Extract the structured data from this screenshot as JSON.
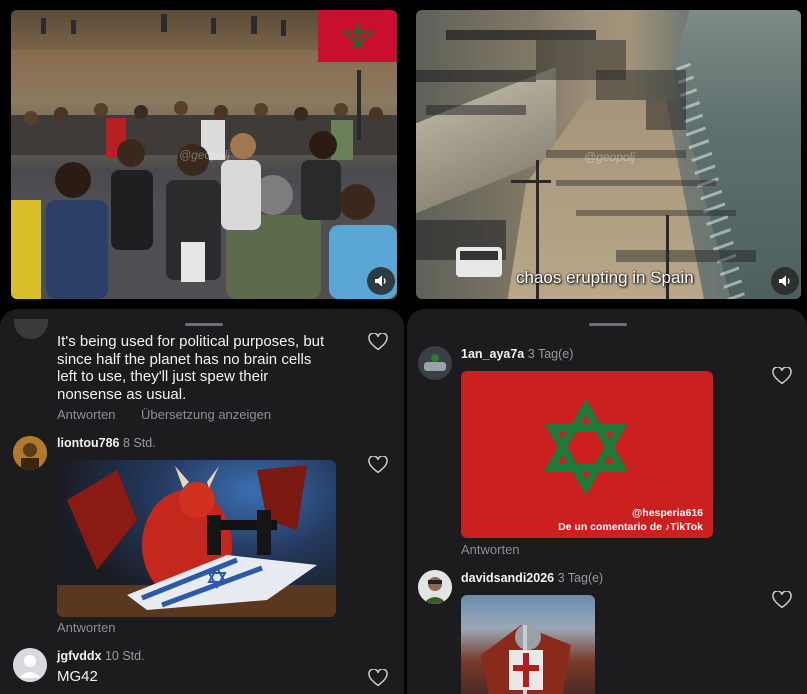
{
  "left_video": {
    "watermark": "@geopolj",
    "icons": {
      "flag": "morocco-flag",
      "volume": "speaker-icon"
    }
  },
  "right_video": {
    "caption": "chaos erupting in Spain",
    "watermark": "@geopolj",
    "icons": {
      "volume": "speaker-icon"
    }
  },
  "left_comments": {
    "partial_comment": {
      "text_lines": [
        "It's being used for political purposes, but",
        "since half the planet has no brain cells",
        "left to use, they'll just spew their",
        "nonsense as usual."
      ],
      "reply_label": "Antworten",
      "translate_label": "Übersetzung anzeigen"
    },
    "comment2": {
      "username": "liontou786",
      "time": "8 Std.",
      "reply_label": "Antworten"
    },
    "comment3": {
      "username": "jgfvddx",
      "time": "10 Std.",
      "text": "MG42"
    }
  },
  "right_comments": {
    "comment1": {
      "username": "1an_aya7a",
      "time": "3 Tag(e)",
      "image_credit_handle": "@hesperia616",
      "image_credit_line": "De un comentario de",
      "image_credit_brand": "TikTok",
      "reply_label": "Antworten"
    },
    "comment2": {
      "username": "davidsandi2026",
      "time": "3 Tag(e)"
    }
  },
  "colors": {
    "panel_bg": "#1c1c1e",
    "text": "#f2f2f2",
    "muted": "#8e8e93",
    "flag_red": "#cc1f1f",
    "star_green": "#1f7a3a"
  }
}
